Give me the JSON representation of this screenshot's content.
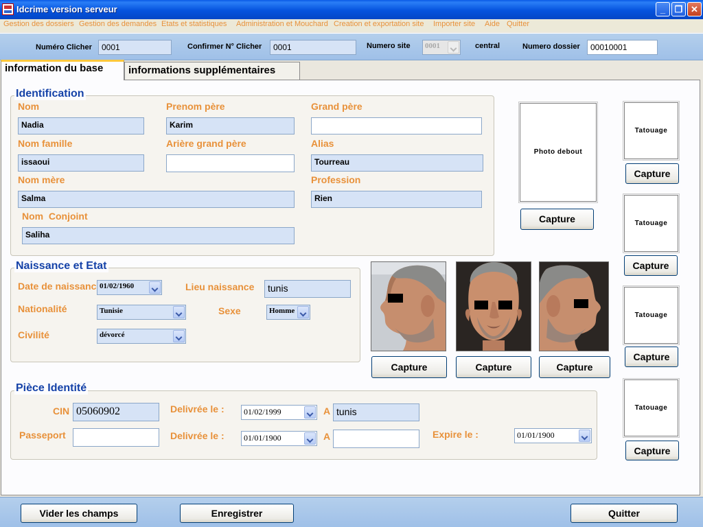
{
  "window": {
    "title": "Idcrime version serveur",
    "minimize_glyph": "_",
    "maximize_glyph": "❐",
    "close_glyph": "✕"
  },
  "menu": [
    "Gestion des dossiers",
    "Gestion des demandes",
    "Etats et statistiques",
    "Administration et Mouchard",
    "Creation et exportation site",
    "Importer site",
    "Aide",
    "Quitter"
  ],
  "header": {
    "numero_clicher_label": "Numéro Clicher",
    "numero_clicher_value": "0001",
    "confirmer_label": "Confirmer N° Clicher",
    "confirmer_value": "0001",
    "numero_site_label": "Numero site",
    "numero_site_value": "0001",
    "site_name": "central",
    "numero_dossier_label": "Numero dossier",
    "numero_dossier_value": "00010001"
  },
  "tabs": [
    "information du base",
    "informations supplémentaires"
  ],
  "identification": {
    "title": "Identification",
    "nom_label": "Nom",
    "nom_value": "Nadia",
    "prenom_pere_label": "Prenom père",
    "prenom_pere_value": "Karim",
    "grand_pere_label": "Grand père",
    "grand_pere_value": "",
    "nom_famille_label": "Nom famille",
    "nom_famille_value": "issaoui",
    "ariere_label": "Arière grand père",
    "ariere_value": "",
    "alias_label": "Alias",
    "alias_value": "Tourreau",
    "nom_mere_label": "Nom mère",
    "nom_mere_value": "Salma",
    "profession_label": "Profession",
    "profession_value": "Rien",
    "conjoint_label": "Nom  Conjoint",
    "conjoint_value": "Saliha"
  },
  "naissance": {
    "title": "Naissance et Etat",
    "date_label": "Date de naissance",
    "date_value": "01/02/1960",
    "lieu_label": "Lieu naissance",
    "lieu_value": "tunis",
    "nationalite_label": "Nationalité",
    "nationalite_value": "Tunisie",
    "sexe_label": "Sexe",
    "sexe_value": "Homme",
    "civilite_label": "Civilité",
    "civilite_value": "dévorcé"
  },
  "piece": {
    "title": "Pièce Identité",
    "cin_label": "CIN",
    "cin_value": "05060902",
    "delivree_label": "Delivrée le :",
    "cin_date": "01/02/1999",
    "a_label": "A",
    "cin_lieu": "tunis",
    "passeport_label": "Passeport",
    "passeport_value": "",
    "passeport_date": "01/01/1900",
    "passeport_lieu": "",
    "expire_label": "Expire le :",
    "expire_date": "01/01/1900"
  },
  "photos": {
    "debout_label": "Photo debout",
    "tatouage_label": "Tatouage",
    "capture_label": "Capture"
  },
  "footer": {
    "vider": "Vider les champs",
    "enregistrer": "Enregistrer",
    "quitter": "Quitter"
  },
  "colors": {
    "label_orange": "#e8913a",
    "group_title_blue": "#1542a8",
    "field_blue": "#d6e3f6",
    "titlebar_blue": "#0553de"
  }
}
